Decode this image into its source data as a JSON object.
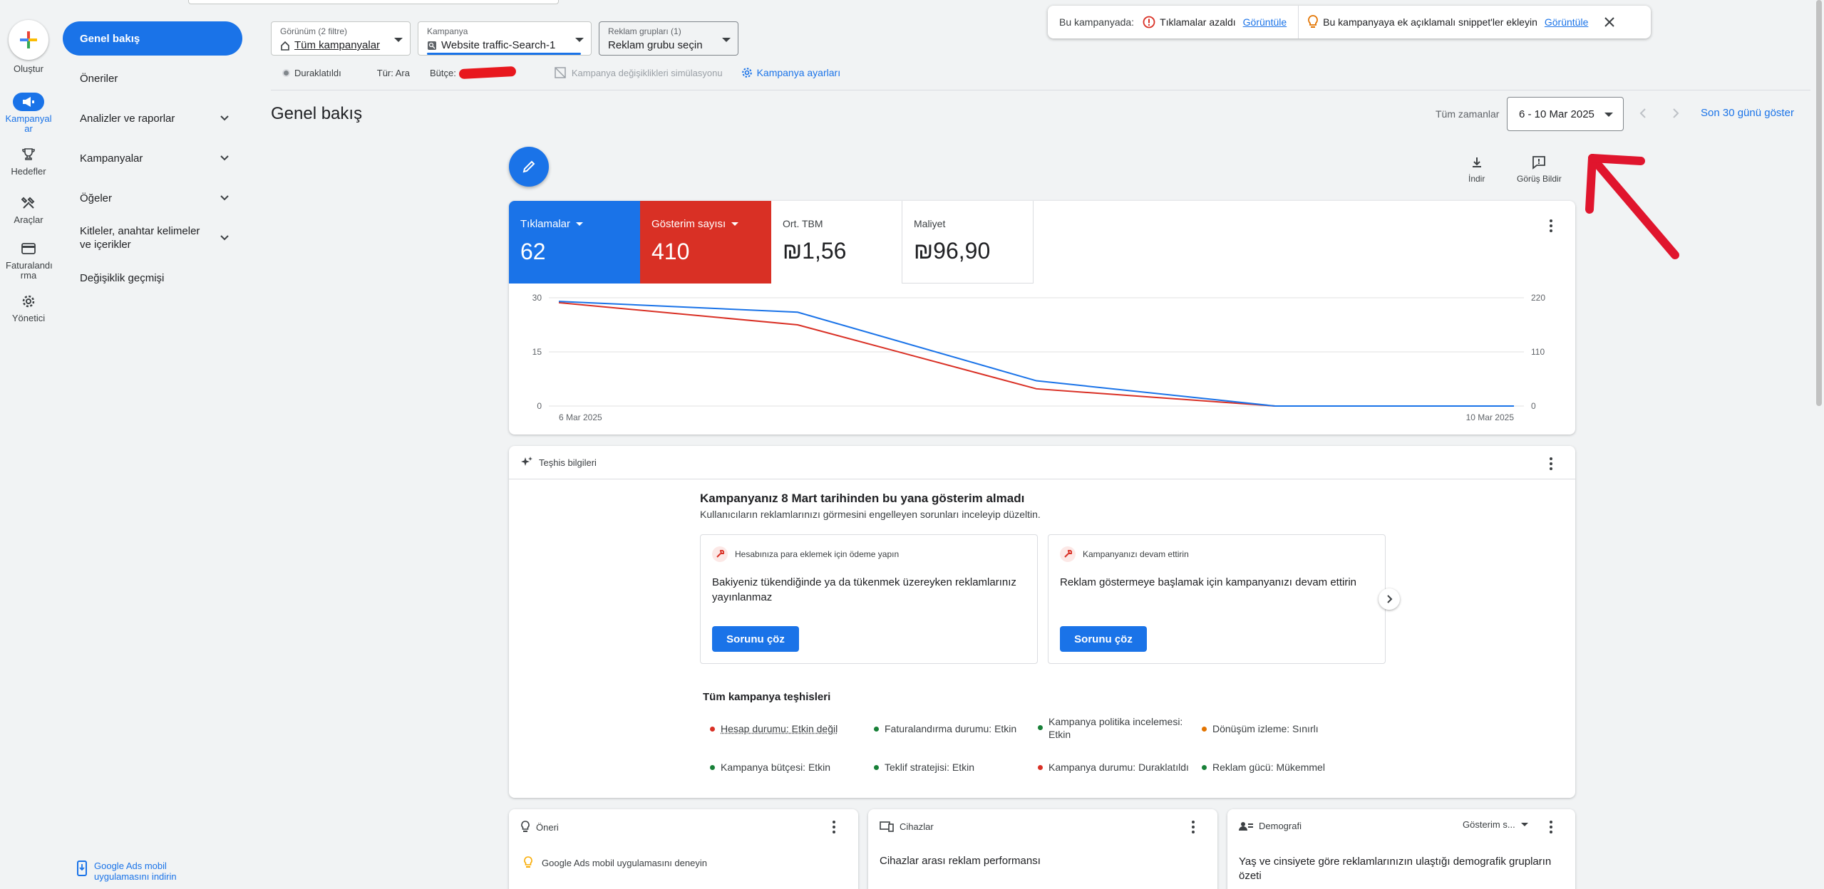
{
  "rail": {
    "create": "Oluştur",
    "items": [
      {
        "label": "Kampanyal ar",
        "icon": "megaphone-icon"
      },
      {
        "label": "Hedefler",
        "icon": "trophy-icon"
      },
      {
        "label": "Araçlar",
        "icon": "tools-icon"
      },
      {
        "label": "Faturalandı rma",
        "icon": "credit-card-icon"
      },
      {
        "label": "Yönetici",
        "icon": "gear-icon"
      }
    ]
  },
  "sidebar": {
    "items": [
      {
        "label": "Genel bakış",
        "expandable": false
      },
      {
        "label": "Öneriler",
        "expandable": false
      },
      {
        "label": "Analizler ve raporlar",
        "expandable": true
      },
      {
        "label": "Kampanyalar",
        "expandable": true
      },
      {
        "label": "Öğeler",
        "expandable": true
      },
      {
        "label": "Kitleler, anahtar kelimeler ve içerikler",
        "expandable": true
      },
      {
        "label": "Değişiklik geçmişi",
        "expandable": false
      }
    ],
    "mobile_app": "Google Ads mobil uygulamasını indirin"
  },
  "topbar": {
    "view_label": "Görünüm (2 filtre)",
    "view_value": "Tüm kampanyalar",
    "campaign_label": "Kampanya",
    "campaign_value": "Website traffic-Search-1",
    "adgroup_label": "Reklam grupları (1)",
    "adgroup_value": "Reklam grubu seçin"
  },
  "status": {
    "state": "Duraklatıldı",
    "type": "Tür: Ara",
    "budget_label": "Bütçe:",
    "simulation": "Kampanya değişiklikleri simülasyonu",
    "settings": "Kampanya ayarları"
  },
  "notice": {
    "prefix": "Bu kampanyada:",
    "alert": "Tıklamalar azaldı",
    "view1": "Görüntüle",
    "tip": "Bu kampanyaya ek açıklamalı snippet'ler ekleyin",
    "view2": "Görüntüle"
  },
  "header": {
    "title": "Genel bakış",
    "range_label": "Tüm zamanlar",
    "date_range": "6 - 10 Mar 2025",
    "last30": "Son 30 günü göster"
  },
  "toolbar": {
    "download": "İndir",
    "feedback": "Görüş Bildir"
  },
  "metrics": [
    {
      "label": "Tıklamalar",
      "value": "62",
      "color": "#1a73e8",
      "active": true
    },
    {
      "label": "Gösterim sayısı",
      "value": "410",
      "color": "#d93025",
      "active": true
    },
    {
      "label": "Ort. TBM",
      "value": "₪1,56",
      "active": false
    },
    {
      "label": "Maliyet",
      "value": "₪96,90",
      "active": false
    }
  ],
  "chart_data": {
    "type": "line",
    "x": [
      "6 Mar 2025",
      "7 Mar 2025",
      "8 Mar 2025",
      "9 Mar 2025",
      "10 Mar 2025"
    ],
    "x_tick_labels": [
      "6 Mar 2025",
      "10 Mar 2025"
    ],
    "series": [
      {
        "name": "Tıklamalar",
        "axis": "left",
        "color": "#1a73e8",
        "values": [
          29,
          26,
          7,
          0,
          0
        ]
      },
      {
        "name": "Gösterim sayısı",
        "axis": "right",
        "color": "#d93025",
        "values": [
          210,
          165,
          35,
          0,
          0
        ]
      }
    ],
    "ylim_left": [
      0,
      30
    ],
    "yticks_left": [
      "0",
      "15",
      "30"
    ],
    "ylim_right": [
      0,
      220
    ],
    "yticks_right": [
      "0",
      "110",
      "220"
    ],
    "grid": true
  },
  "diagnostics": {
    "header": "Teşhis bilgileri",
    "title": "Kampanyanız 8 Mart tarihinden bu yana gösterim almadı",
    "subtitle": "Kullanıcıların reklamlarınızı görmesini engelleyen sorunları inceleyip düzeltin.",
    "cards": [
      {
        "tag": "Hesabınıza para eklemek için ödeme yapın",
        "body": "Bakiyeniz tükendiğinde ya da tükenmek üzereyken reklamlarınız yayınlanmaz",
        "button": "Sorunu çöz"
      },
      {
        "tag": "Kampanyanızı devam ettirin",
        "body": "Reklam göstermeye başlamak için kampanyanızı devam ettirin",
        "button": "Sorunu çöz"
      }
    ],
    "all_title": "Tüm kampanya teşhisleri",
    "stats": [
      {
        "text": "Hesap durumu: Etkin değil",
        "color": "#d93025",
        "link": true
      },
      {
        "text": "Faturalandırma durumu: Etkin",
        "color": "#188038",
        "link": false
      },
      {
        "text": "Kampanya politika incelemesi: Etkin",
        "color": "#188038",
        "link": false
      },
      {
        "text": "Dönüşüm izleme: Sınırlı",
        "color": "#e37400",
        "link": false
      },
      {
        "text": "Kampanya bütçesi: Etkin",
        "color": "#188038",
        "link": false
      },
      {
        "text": "Teklif stratejisi: Etkin",
        "color": "#188038",
        "link": false
      },
      {
        "text": "Kampanya durumu: Duraklatıldı",
        "color": "#d93025",
        "link": false
      },
      {
        "text": "Reklam gücü: Mükemmel",
        "color": "#188038",
        "link": false
      }
    ]
  },
  "bottom_cards": {
    "oneri_title": "Öneri",
    "oneri_text": "Google Ads mobil uygulamasını deneyin",
    "devices_title": "Cihazlar",
    "devices_text": "Cihazlar arası reklam performansı",
    "demo_title": "Demografi",
    "demo_select": "Gösterim s...",
    "demo_text": "Yaş ve cinsiyete göre reklamlarınızın ulaştığı demografik grupların özeti"
  }
}
